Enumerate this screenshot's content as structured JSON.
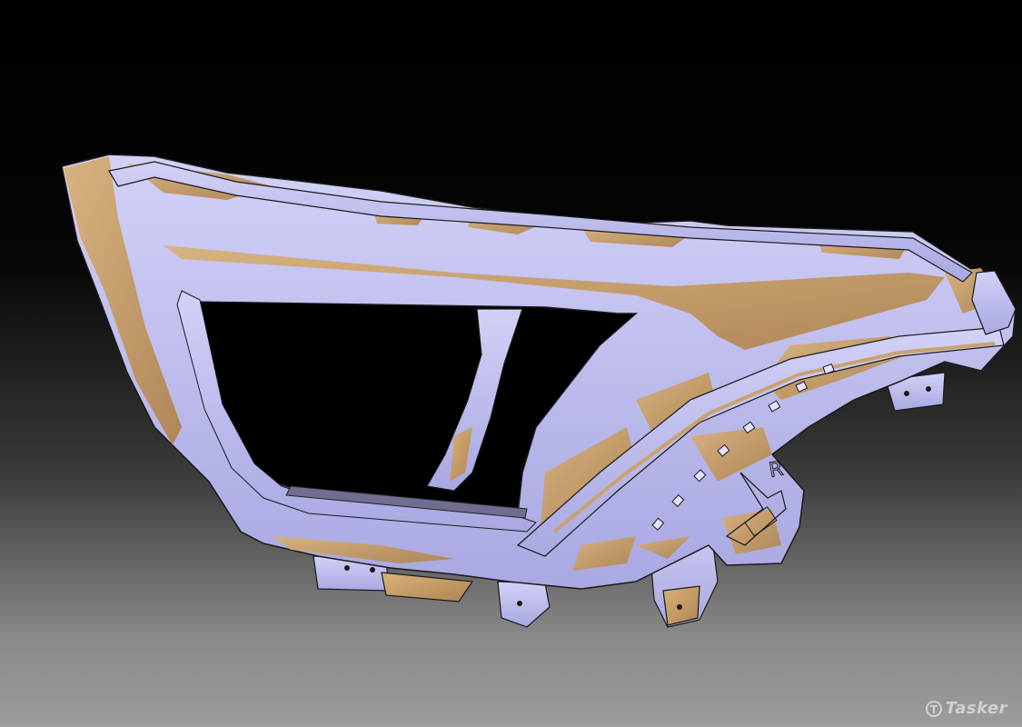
{
  "viewport": {
    "background_top": "#000000",
    "background_bottom": "#9c9c9c"
  },
  "model": {
    "name": "headlamp-bezel-part",
    "color_primary": "#b7b6ea",
    "color_secondary": "#c9a26e",
    "edge_color": "#1a1a1a",
    "embossed_marking": "R"
  },
  "watermark": {
    "logo_icon": "tasker-logo-icon",
    "text": "Tasker"
  }
}
